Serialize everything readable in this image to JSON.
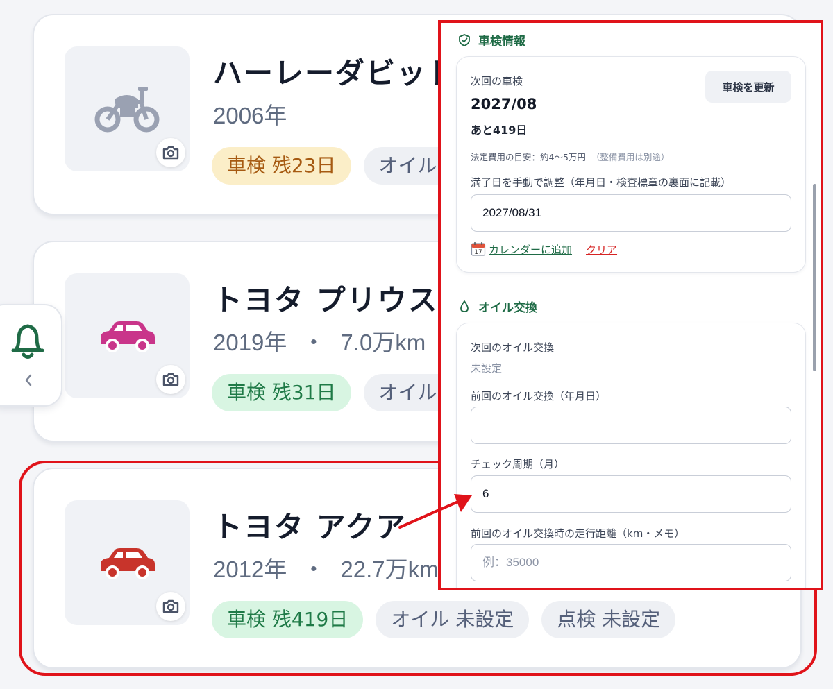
{
  "vehicles": [
    {
      "name": "ハーレーダビッドソン",
      "meta": "2006年",
      "badges": [
        "車検 残23日",
        "オイル 未設定"
      ],
      "icon": "motorcycle-icon"
    },
    {
      "name": "トヨタ プリウス",
      "year": "2019年",
      "mileage": "7.0万km",
      "badges": [
        "車検 残31日",
        "オイル 未設定"
      ],
      "icon": "car-icon"
    },
    {
      "name": "トヨタ アクア",
      "year": "2012年",
      "mileage": "22.7万km",
      "badges": [
        "車検 残419日",
        "オイル 未設定",
        "点検 未設定"
      ],
      "icon": "car-icon"
    }
  ],
  "meta_separator": "・",
  "panel": {
    "inspection": {
      "title": "車検情報",
      "next_label": "次回の車検",
      "next_date": "2027/08",
      "remaining": "あと419日",
      "update_button": "車検を更新",
      "fee_note": "法定費用の目安：約4〜5万円",
      "fee_note_paren": "（整備費用は別途）",
      "manual_label": "満了日を手動で調整（年月日・検査標章の裏面に記載）",
      "manual_value": "2027/08/31",
      "calendar_link": "カレンダーに追加",
      "calendar_day": "17",
      "clear_link": "クリア"
    },
    "oil": {
      "title": "オイル交換",
      "next_label": "次回のオイル交換",
      "next_value": "未設定",
      "last_label": "前回のオイル交換（年月日）",
      "last_value": "",
      "cycle_label": "チェック周期（月）",
      "cycle_value": "6",
      "mileage_label": "前回のオイル交換時の走行距離（km・メモ）",
      "mileage_placeholder": "例：35000"
    }
  },
  "colors": {
    "accent_green": "#1f6b46",
    "highlight_red": "#e0131a",
    "harley_icon": "#9aa1b2",
    "prius_icon": "#c9358a",
    "aqua_icon": "#c8342b"
  }
}
